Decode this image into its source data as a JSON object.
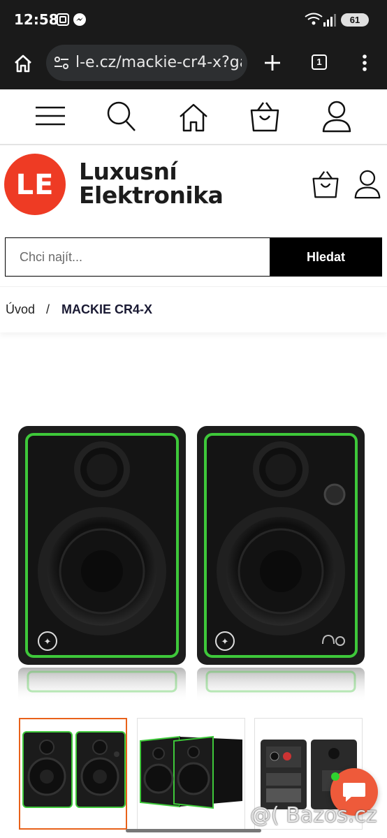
{
  "status_bar": {
    "time": "12:58",
    "battery": "61"
  },
  "browser": {
    "url": "l-e.cz/mackie-cr4-x?gad",
    "tab_count": "1"
  },
  "brand": {
    "line1": "Luxusní",
    "line2": "Elektronika",
    "logo_text": "LE",
    "logo_color": "#ee3b24"
  },
  "search": {
    "placeholder": "Chci najít...",
    "button_label": "Hledat"
  },
  "breadcrumb": {
    "home": "Úvod",
    "separator": "/",
    "current": "MACKIE CR4-X"
  },
  "product": {
    "accent_color": "#3ec83a"
  },
  "thumbnails": {
    "active_border_color": "#e8611a"
  },
  "watermark": "@( Bazos.cz",
  "chat": {
    "color": "#ee5a3a"
  }
}
